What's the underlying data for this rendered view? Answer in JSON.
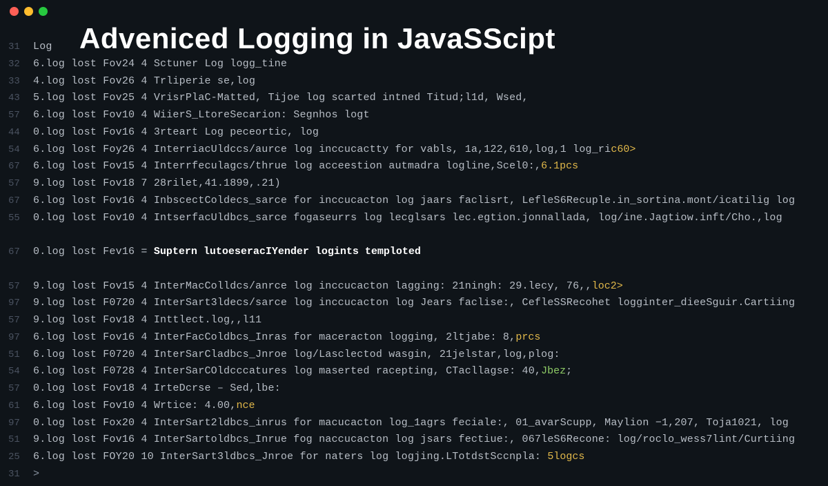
{
  "traffic": {
    "red": "",
    "yellow": "",
    "green": ""
  },
  "title": "Adveniced Logging in  JavaSScipt",
  "lines": [
    {
      "ln": "31",
      "pre": "Log"
    },
    {
      "ln": "32",
      "pre": "6.log lost Fov24 4 Sctuner Log logg_tine"
    },
    {
      "ln": "33",
      "pre": "4.log lost Fov26 4 Trliperie se,log"
    },
    {
      "ln": "43",
      "pre": "5.log lost Fov25 4 VrisrPlaC-Matted, Tijoe log scarted intned Titud;l1d, Wsed,"
    },
    {
      "ln": "57",
      "pre": "6.log lost Fov10 4 WiierS_LtoreSecarion: Segnhos logt"
    },
    {
      "ln": "44",
      "pre": "0.log lost Fov16 4 3rteart Log peceortic, log"
    },
    {
      "ln": "54",
      "pre": "6.log lost Foy26 4 InterriacUldccs/aurce log inccucactty for vabls, 1a,122,610,log,1 log_ri",
      "hl": "c60>",
      "hlClass": "hl-yellow"
    },
    {
      "ln": "67",
      "pre": "6.log lost Fov15 4 Interrfeculagcs/thrue log acceestion autmadra logline,Scel0:,",
      "hl": "6.1pcs",
      "hlClass": "hl-yellow"
    },
    {
      "ln": "57",
      "pre": "9.log lost Fov18 7 28rilet,41.1899,.21)"
    },
    {
      "ln": "67",
      "pre": "6.log lost Fov16 4 InbscectColdecs_sarce for inccucacton log jaars faclisrt, LefleS6Recuple.in_sortina.mont/icatilig log"
    },
    {
      "ln": "55",
      "pre": "0.log lost Fov10 4 IntserfacUldbcs_sarce fogaseurrs log lecglsars lec.egtion.jonnallada, log/ine.Jagtiow.inft/Cho.,log"
    },
    {
      "ln": "blank1"
    },
    {
      "ln": "67",
      "pre": "0.log lost Fev16 = ",
      "bold": "Suptern lutoeseracIYender logints temploted"
    },
    {
      "ln": "blank2"
    },
    {
      "ln": "57",
      "pre": "9.log lost Fov15 4 InterMacColldcs/anrce log inccucacton lagging: ",
      "mid": "21ningh",
      "post": ": 29.lecy, 76,,",
      "hl": "loc2>",
      "hlClass": "hl-yellow"
    },
    {
      "ln": "97",
      "pre": "9.log lost F0720 4 InterSart3ldecs/sarce log inccucacton log Jears faclise:, CefleSSRecohet logginter_dieeSguir.Cartiing"
    },
    {
      "ln": "57",
      "pre": "9.log lost Fov18 4 Inttlect.log,,l11"
    },
    {
      "ln": "97",
      "pre": "6.log lost Fov16 4 InterFacColdbcs_Inras for maceracton logging, 2ltjabe: 8,",
      "hl": "prcs",
      "hlClass": "hl-yellow"
    },
    {
      "ln": "51",
      "pre": "6.log lost F0720 4 InterSarCladbcs_Jnroe log/Lasclectod wasgin, 21jelstar,log,plog:"
    },
    {
      "ln": "54",
      "pre": "6.log lost F0728 4 InterSarCOldcccatures log maserted racepting, CTacllagse: 40,",
      "hl": "Jbez",
      "hlClass": "hl-green",
      "tail": ";"
    },
    {
      "ln": "57",
      "pre": "0.log lost Fov18 4 IrteDcrse – Sed,lbe:"
    },
    {
      "ln": "61",
      "pre": "6.log lost Fov10 4 Wrtice: 4.00,",
      "hl": "nce",
      "hlClass": "hl-yellow"
    },
    {
      "ln": "97",
      "pre": "0.log lost Fox20 4 InterSart2ldbcs_inrus for macucacton log_1agrs feciale:, 01_avarScupp, Maylion −1,207, Toja1021, log"
    },
    {
      "ln": "51",
      "pre": "9.log lost Fov16 4 InterSartoldbcs_Inrue fog naccucacton log jsars fectiue:, 067leS6Recone: log/roclo_wess7lint/Curtiing"
    },
    {
      "ln": "25",
      "pre": "6.log lost FOY20 10 InterSart3ldbcs_Jnroe for naters log logjing.LTotdstSccnpla: ",
      "hl": "5logcs",
      "hlClass": "hl-yellow"
    },
    {
      "ln": "31",
      "prompt": ">"
    }
  ]
}
